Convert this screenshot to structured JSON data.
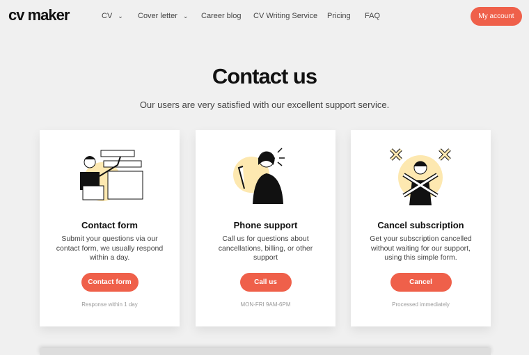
{
  "header": {
    "logo": "cv maker",
    "nav": [
      {
        "label": "CV",
        "dropdown": true
      },
      {
        "label": "Cover letter",
        "dropdown": true
      },
      {
        "label": "Career blog"
      },
      {
        "label": "CV Writing Service"
      },
      {
        "label": "Pricing"
      },
      {
        "label": "FAQ"
      }
    ],
    "account_label": "My account"
  },
  "main": {
    "title": "Contact us",
    "subtitle": "Our users are very satisfied with our excellent support service.",
    "cards": [
      {
        "title": "Contact form",
        "description": "Submit your questions via our contact form, we usually respond within a day.",
        "button": "Contact form",
        "note": "Response within 1 day"
      },
      {
        "title": "Phone support",
        "description": "Call us for questions about cancellations, billing, or other support",
        "button": "Call us",
        "note": "MON-FRI 9AM-6PM"
      },
      {
        "title": "Cancel subscription",
        "description": "Get your subscription cancelled without waiting for our support, using this simple form.",
        "button": "Cancel",
        "note": "Processed immediately"
      }
    ]
  },
  "colors": {
    "accent": "#ef604a",
    "illustration_bg": "#fde8b0"
  }
}
